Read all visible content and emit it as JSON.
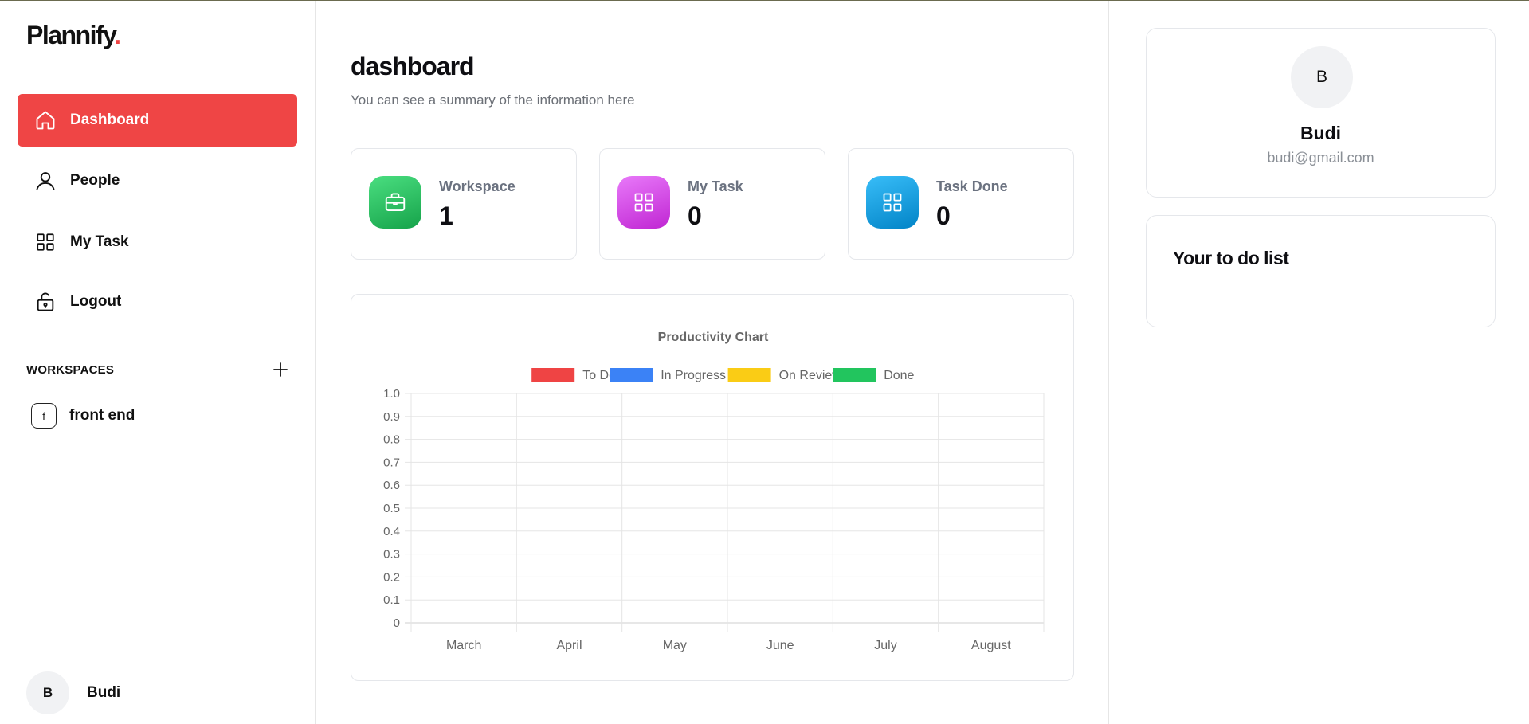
{
  "app": {
    "logo_text": "Plannify",
    "logo_dot": ".",
    "accent_color": "#ef4545"
  },
  "sidebar": {
    "items": [
      {
        "label": "Dashboard",
        "icon": "home-icon",
        "active": true
      },
      {
        "label": "People",
        "icon": "user-icon",
        "active": false
      },
      {
        "label": "My Task",
        "icon": "grid-icon",
        "active": false
      },
      {
        "label": "Logout",
        "icon": "unlock-icon",
        "active": false
      }
    ],
    "workspaces_title": "WORKSPACES",
    "add_icon": "plus-icon",
    "workspaces": [
      {
        "badge": "f",
        "label": "front end"
      }
    ],
    "user": {
      "initial": "B",
      "name": "Budi"
    }
  },
  "main": {
    "title": "dashboard",
    "subtitle": "You can see a summary of the information here",
    "stats": [
      {
        "label": "Workspace",
        "value": "1",
        "icon": "briefcase-icon",
        "gradient_from": "#4ade80",
        "gradient_to": "#16a34a"
      },
      {
        "label": "My Task",
        "value": "0",
        "icon": "grid-icon",
        "gradient_from": "#e879f9",
        "gradient_to": "#c026d3"
      },
      {
        "label": "Task Done",
        "value": "0",
        "icon": "grid-icon",
        "gradient_from": "#38bdf8",
        "gradient_to": "#0284c7"
      }
    ]
  },
  "chart_data": {
    "type": "bar",
    "title": "Productivity Chart",
    "categories": [
      "March",
      "April",
      "May",
      "June",
      "July",
      "August"
    ],
    "series": [
      {
        "name": "To Do",
        "color": "#ef4444",
        "values": [
          0,
          0,
          0,
          0,
          0,
          0
        ]
      },
      {
        "name": "In Progress",
        "color": "#3b82f6",
        "values": [
          0,
          0,
          0,
          0,
          0,
          0
        ]
      },
      {
        "name": "On Review",
        "color": "#facc15",
        "values": [
          0,
          0,
          0,
          0,
          0,
          0
        ]
      },
      {
        "name": "Done",
        "color": "#22c55e",
        "values": [
          0,
          0,
          0,
          0,
          0,
          0
        ]
      }
    ],
    "yticks": [
      "1.0",
      "0.9",
      "0.8",
      "0.7",
      "0.6",
      "0.5",
      "0.4",
      "0.3",
      "0.2",
      "0.1",
      "0"
    ],
    "ylim": [
      0,
      1
    ],
    "grid": true,
    "legend_position": "top"
  },
  "profile": {
    "initial": "B",
    "name": "Budi",
    "email": "budi@gmail.com"
  },
  "todo": {
    "title": "Your to do list"
  }
}
